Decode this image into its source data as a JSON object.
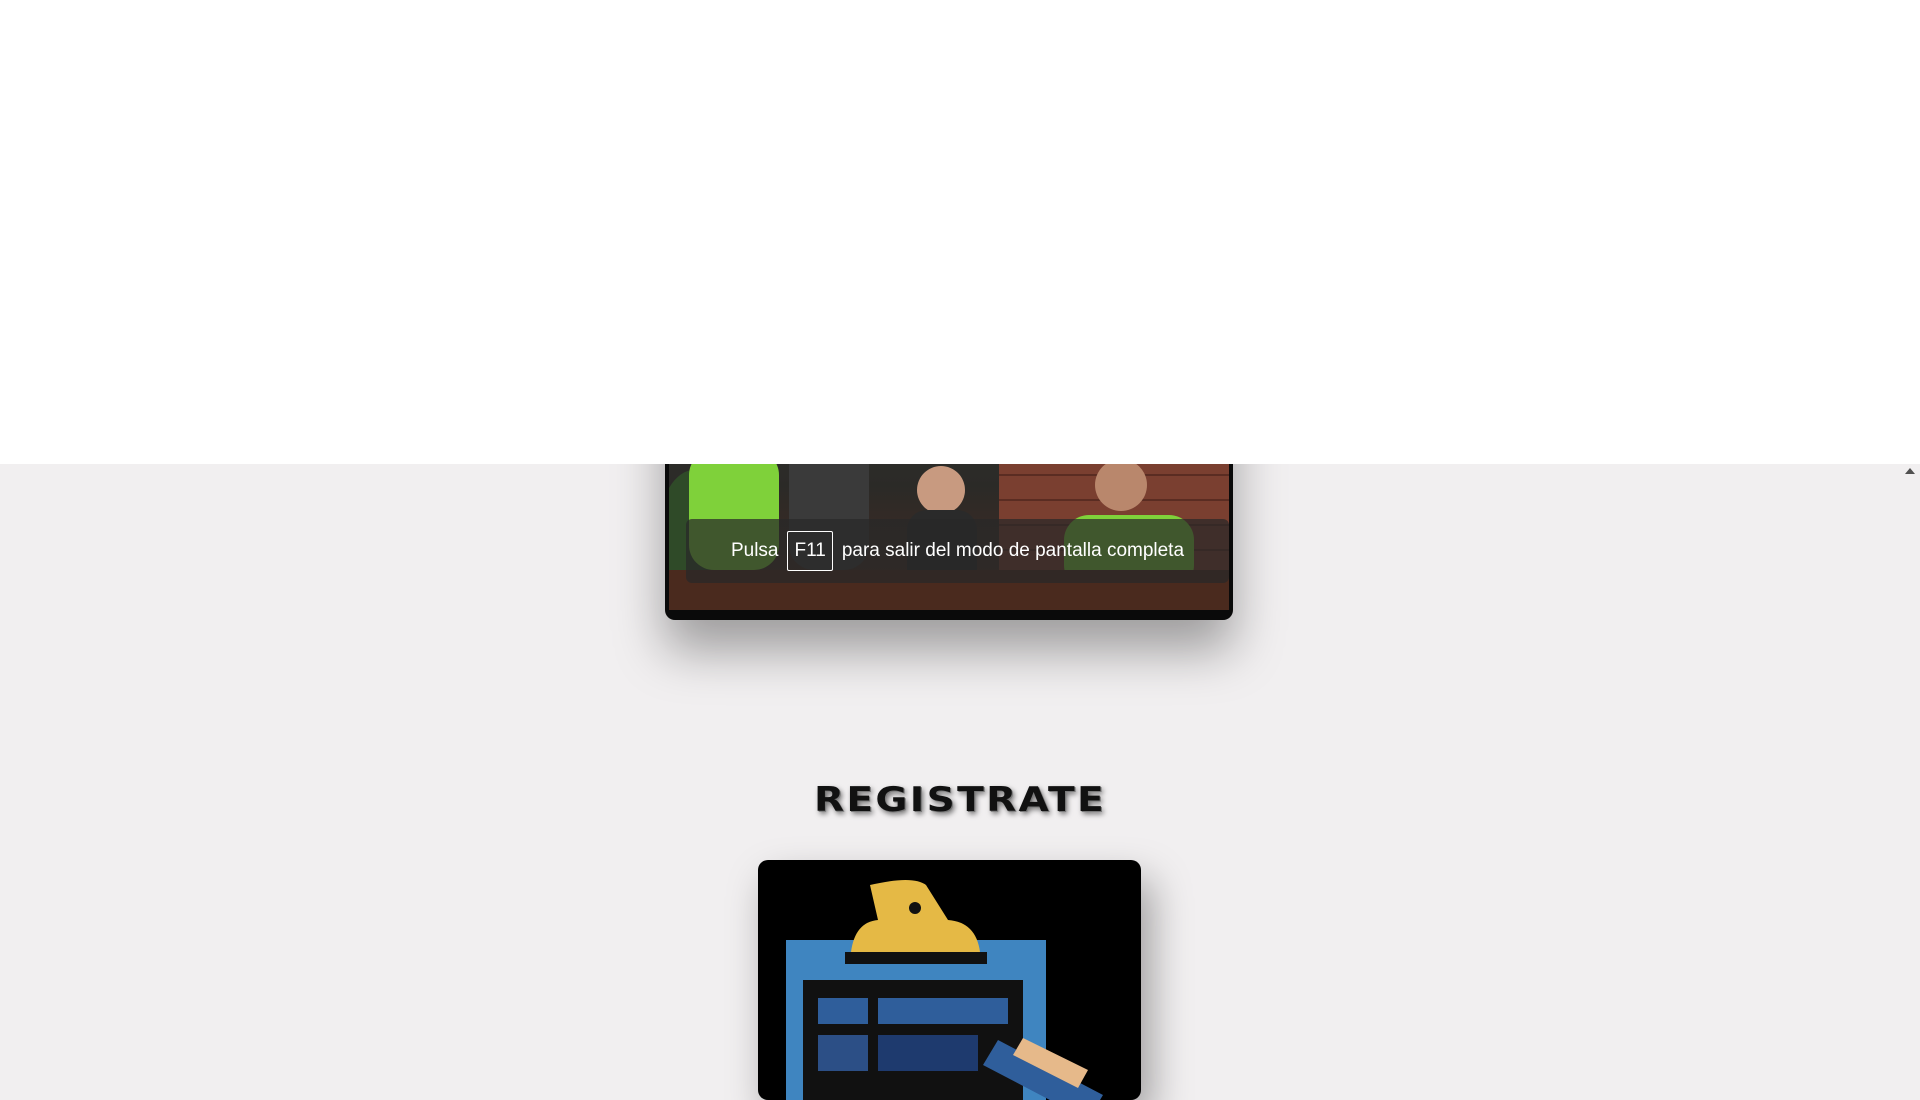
{
  "fullscreen_notice": {
    "prefix": "Pulsa",
    "key": "F11",
    "suffix": "para salir del modo de pantalla completa"
  },
  "register": {
    "heading": "REGISTRATE"
  },
  "images": {
    "team_photo": "team-photo",
    "register_icon": "clipboard-icon"
  },
  "colors": {
    "page_background": "#f1eff0",
    "clipboard_blue": "#3f85c0",
    "clipboard_clip": "#e5b945",
    "toast_background": "#282828"
  }
}
